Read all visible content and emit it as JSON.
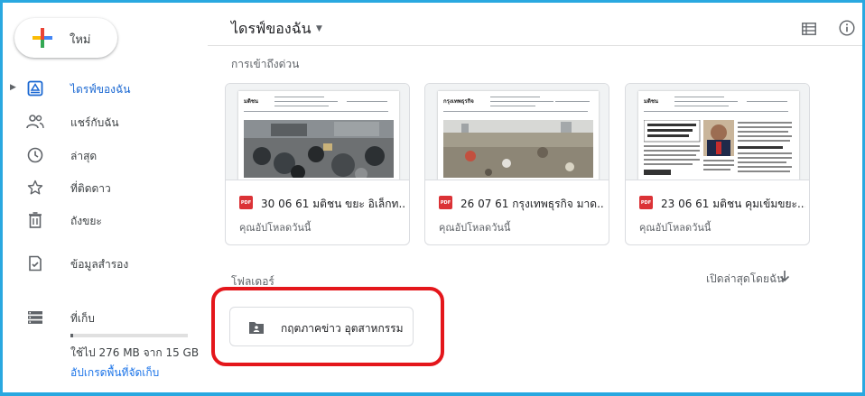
{
  "sidebar": {
    "new_label": "ใหม่",
    "items": [
      {
        "label": "ไดรฟ์ของฉัน",
        "icon": "my-drive-icon",
        "active": true
      },
      {
        "label": "แชร์กับฉัน",
        "icon": "shared-with-me-icon",
        "active": false
      },
      {
        "label": "ล่าสุด",
        "icon": "clock-icon",
        "active": false
      },
      {
        "label": "ที่ติดดาว",
        "icon": "star-icon",
        "active": false
      },
      {
        "label": "ถังขยะ",
        "icon": "trash-icon",
        "active": false
      },
      {
        "label": "ข้อมูลสำรอง",
        "icon": "backup-icon",
        "active": false
      },
      {
        "label": "ที่เก็บ",
        "icon": "storage-icon",
        "active": false
      }
    ],
    "storage": {
      "used_text": "ใช้ไป 276 MB จาก 15 GB",
      "used_fraction": 0.02,
      "upgrade_link": "อัปเกรดพื้นที่จัดเก็บ"
    }
  },
  "header": {
    "title": "ไดรฟ์ของฉัน",
    "title_menu_icon": "caret-down-icon",
    "actions": [
      "list-view-icon",
      "info-icon"
    ]
  },
  "quick_access": {
    "label": "การเข้าถึงด่วน",
    "files": [
      {
        "name": "30 06 61 มติชน ขยะ อิเล็กท...",
        "subtitle": "คุณอัปโหลดวันนี้",
        "type_badge": "PDF",
        "thumb_brand": "มติชน",
        "thumb_style": "ewaste"
      },
      {
        "name": "26 07 61 กรุงเทพธุรกิจ มาด...",
        "subtitle": "คุณอัปโหลดวันนี้",
        "type_badge": "PDF",
        "thumb_brand": "กรุงเทพธุรกิจ",
        "thumb_style": "landfill"
      },
      {
        "name": "23 06 61 มติชน คุมเข้มขยะ...",
        "subtitle": "คุณอัปโหลดวันนี้",
        "type_badge": "PDF",
        "thumb_brand": "มติชน",
        "thumb_style": "article"
      }
    ]
  },
  "folders": {
    "label": "โฟลเดอร์",
    "sort_label": "เปิดล่าสุดโดยฉัน",
    "sort_icon": "arrow-down-icon",
    "items": [
      {
        "name": "กฤตภาคข่าว อุตสาหกรรม",
        "icon": "shared-folder-icon"
      }
    ]
  },
  "colors": {
    "accent": "#1967d2",
    "frame": "#29a8e0",
    "highlight": "#e4161b",
    "pdf": "#db3236"
  }
}
